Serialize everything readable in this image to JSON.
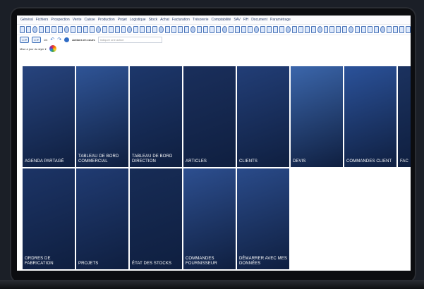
{
  "menu": [
    "Général",
    "Fichiers",
    "Prospection",
    "Vente",
    "Caisse",
    "Production",
    "Projet",
    "Logistique",
    "Stock",
    "Achat",
    "Facturation",
    "Trésorerie",
    "Comptabilité",
    "SAV",
    "RH",
    "Document",
    "Paramétrage"
  ],
  "toolbar2": {
    "page": "1/4",
    "actions_label": "Actions en cours",
    "search_placeholder": "Indiquer une action"
  },
  "style_bar": {
    "label": "Mise à jour du style"
  },
  "tiles": [
    {
      "label": "AGENDA PARTAGÉ",
      "color": "#27447e"
    },
    {
      "label": "TABLEAU DE BORD COMMERCIAL",
      "color": "#2f5496"
    },
    {
      "label": "TABLEAU DE BORD DIRECTION",
      "color": "#1d376b"
    },
    {
      "label": "ARTICLES",
      "color": "#1a2f5c"
    },
    {
      "label": "CLIENTS",
      "color": "#223e77"
    },
    {
      "label": "DEVIS",
      "color": "#3b66ab"
    },
    {
      "label": "COMMANDES CLIENT",
      "color": "#2b529a"
    },
    {
      "label": "FAC",
      "color": "#1b325f"
    },
    {
      "label": "ORDRES DE FABRICATION",
      "color": "#1c3466"
    },
    {
      "label": "PROJETS",
      "color": "#203b72"
    },
    {
      "label": "ÉTAT DES STOCKS",
      "color": "#172c56"
    },
    {
      "label": "COMMANDES FOURNISSEUR",
      "color": "#2d4f90"
    },
    {
      "label": "DÉMARRER AVEC MES DONNÉES",
      "color": "#2a4b8a"
    }
  ]
}
